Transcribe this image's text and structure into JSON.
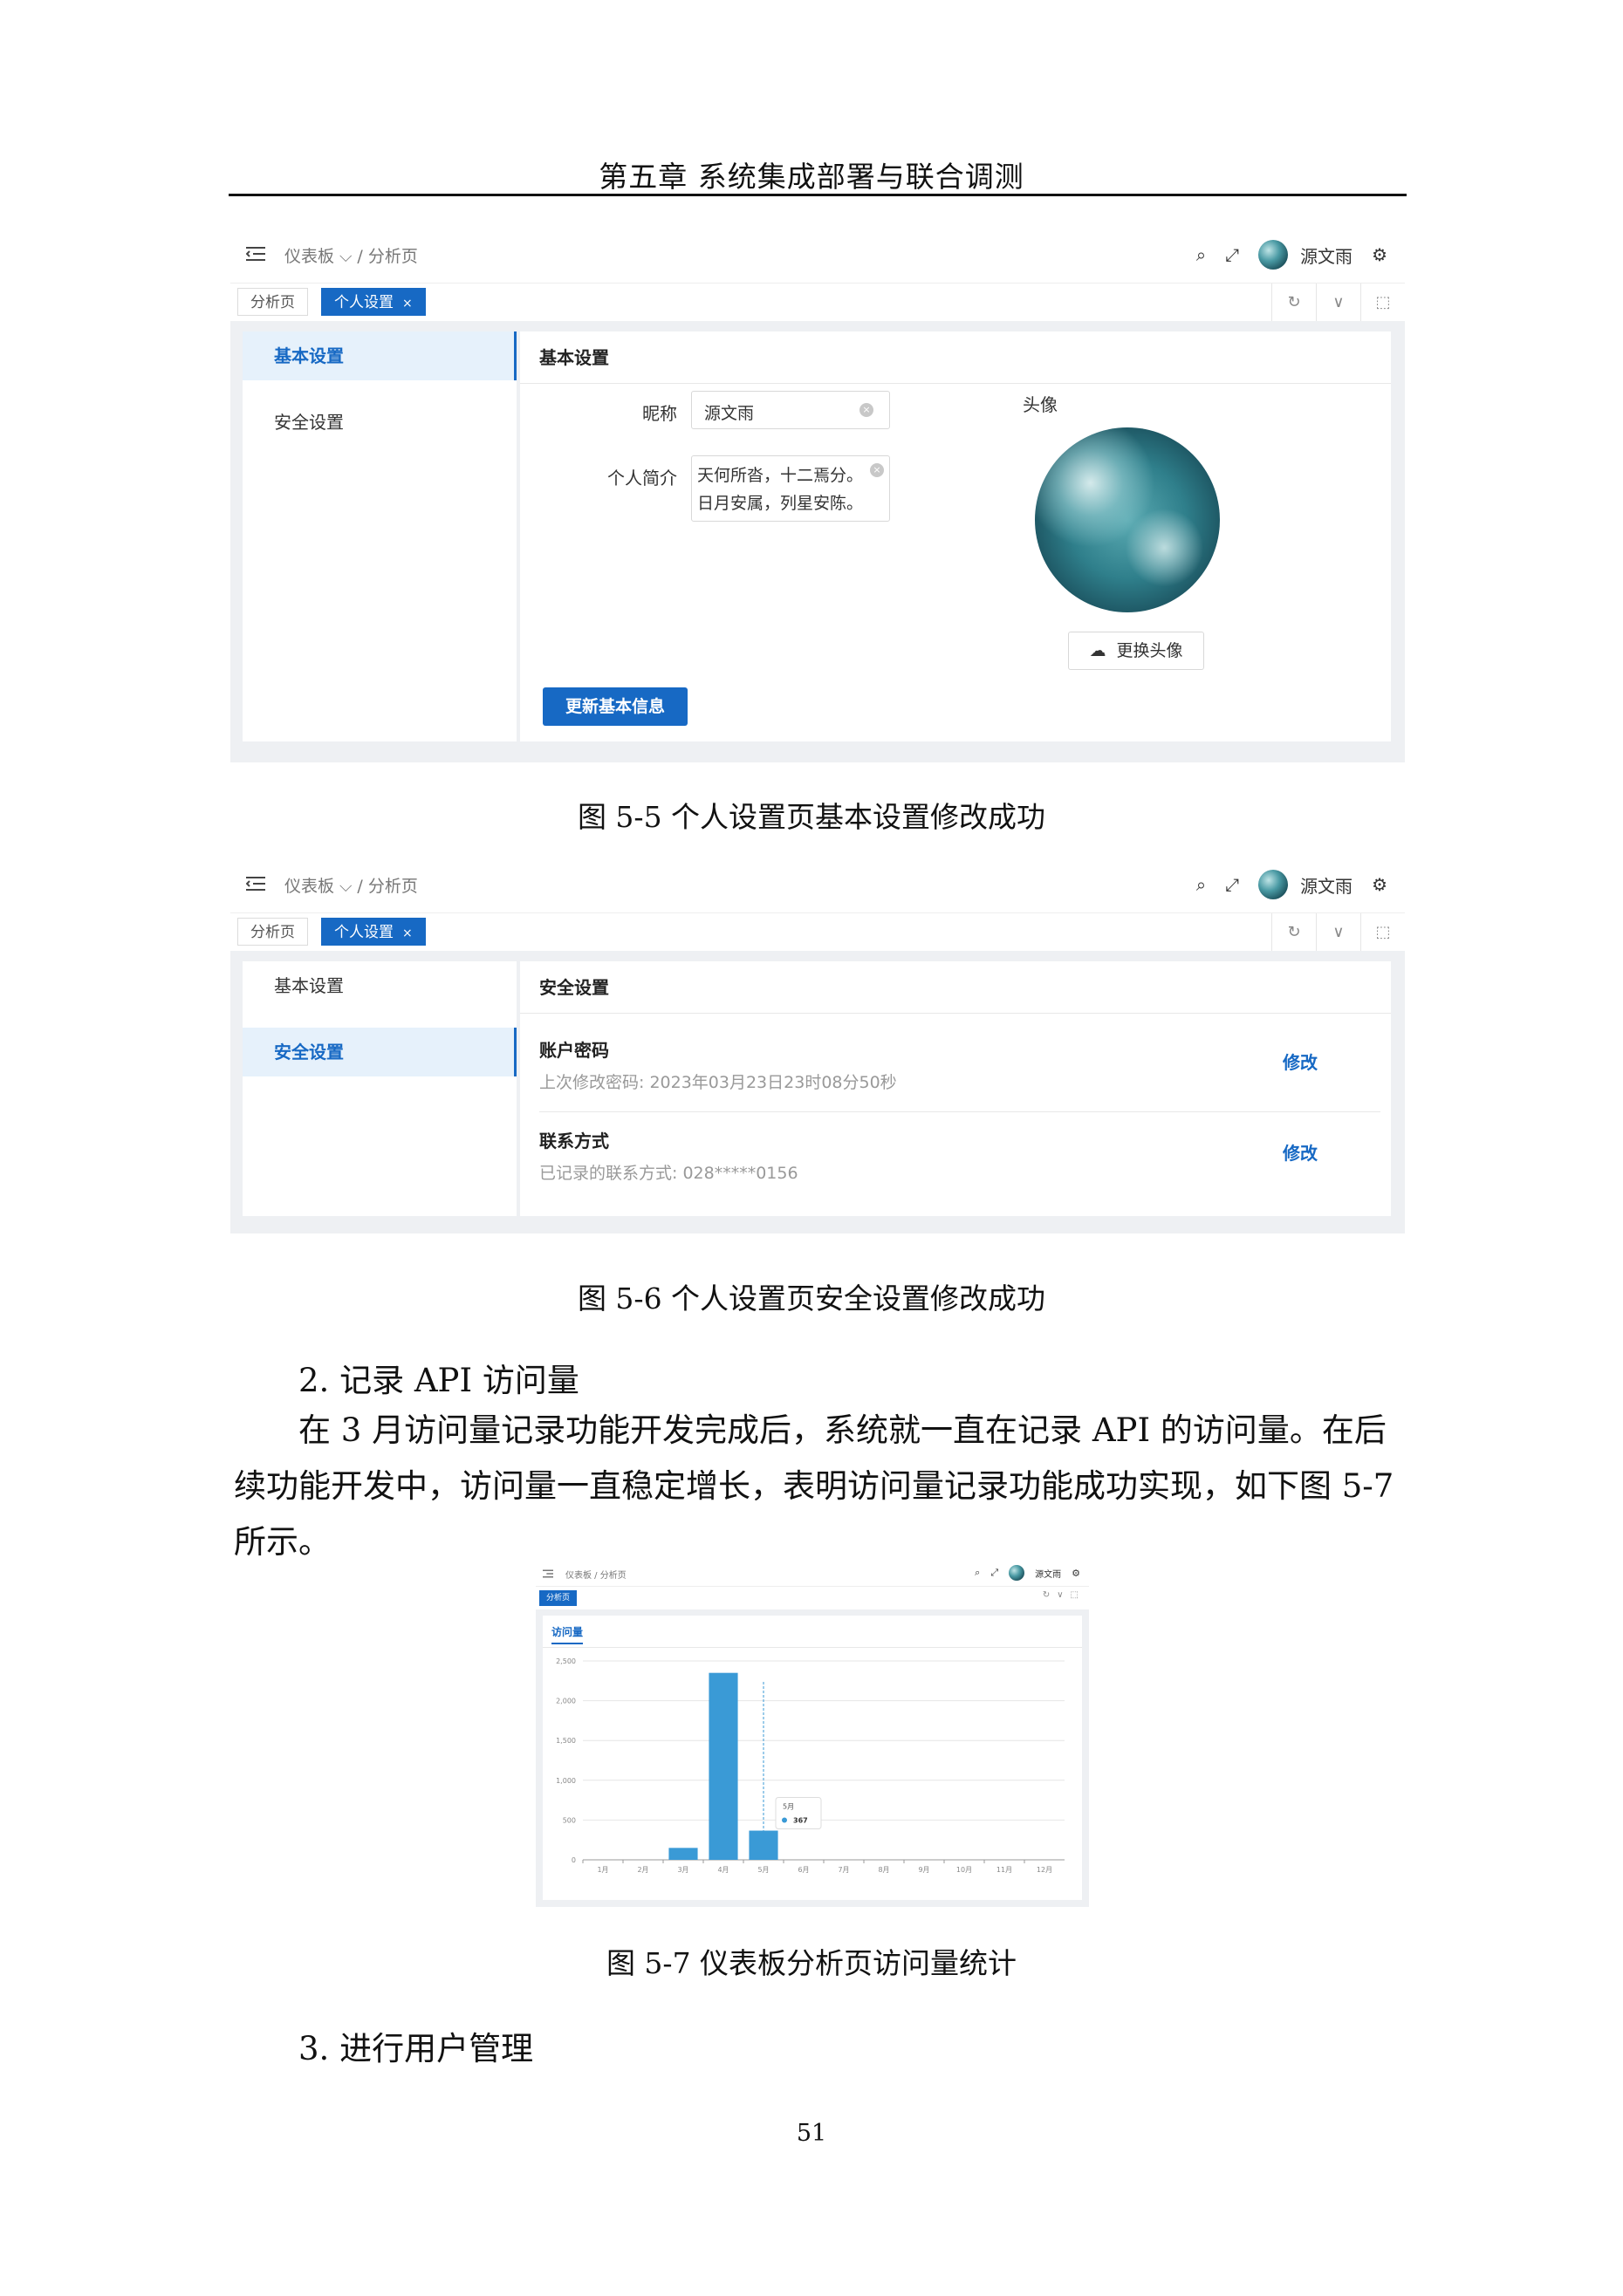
{
  "chapter_header": "第五章  系统集成部署与联合调测",
  "app": {
    "breadcrumb": [
      "仪表板",
      "分析页"
    ],
    "username": "源文雨",
    "tabs": [
      "分析页",
      "个人设置"
    ],
    "tab_close": "×"
  },
  "fig5": {
    "sidebar": [
      "基本设置",
      "安全设置"
    ],
    "panel_title": "基本设置",
    "nickname_label": "昵称",
    "nickname_value": "源文雨",
    "bio_label": "个人简介",
    "bio_lines": [
      "天何所沓，十二焉分。",
      "日月安属，列星安陈。"
    ],
    "avatar_label": "头像",
    "change_avatar_button": "更换头像",
    "update_button": "更新基本信息",
    "caption": "图 5-5  个人设置页基本设置修改成功"
  },
  "fig6": {
    "sidebar": [
      "基本设置",
      "安全设置"
    ],
    "panel_title": "安全设置",
    "items": [
      {
        "title": "账户密码",
        "desc": "上次修改密码: 2023年03月23日23时08分50秒",
        "action": "修改"
      },
      {
        "title": "联系方式",
        "desc": "已记录的联系方式: 028*****0156",
        "action": "修改"
      }
    ],
    "caption": "图 5-6  个人设置页安全设置修改成功"
  },
  "section2": {
    "title": "2.   记录 API 访问量",
    "paragraph_lines": [
      "在 3 月访问量记录功能开发完成后，系统就一直在记录 API 的访问量。在后",
      "续功能开发中，访问量一直稳定增长，表明访问量记录功能成功实现，如下图 5-7",
      "所示。"
    ]
  },
  "fig7": {
    "tab": "分析页",
    "panel_tab": "访问量",
    "tooltip_month": "5月",
    "tooltip_value": "367",
    "caption": "图 5-7  仪表板分析页访问量统计"
  },
  "chart_data": {
    "type": "bar",
    "title": "访问量",
    "categories": [
      "1月",
      "2月",
      "3月",
      "4月",
      "5月",
      "6月",
      "7月",
      "8月",
      "9月",
      "10月",
      "11月",
      "12月"
    ],
    "values": [
      0,
      0,
      150,
      2350,
      367,
      0,
      0,
      0,
      0,
      0,
      0,
      0
    ],
    "yticks": [
      "0",
      "500",
      "1,000",
      "1,500",
      "2,000",
      "2,500"
    ],
    "ylim": [
      0,
      2500
    ],
    "grid": true,
    "bar_color": "#3a9ad6",
    "tooltip": {
      "category": "5月",
      "value": "367"
    }
  },
  "section3": {
    "title": "3.   进行用户管理"
  },
  "page_number": "51",
  "colors": {
    "primary": "#1769c4",
    "content_bg": "#eef0f3",
    "bar": "#3a9ad6"
  }
}
